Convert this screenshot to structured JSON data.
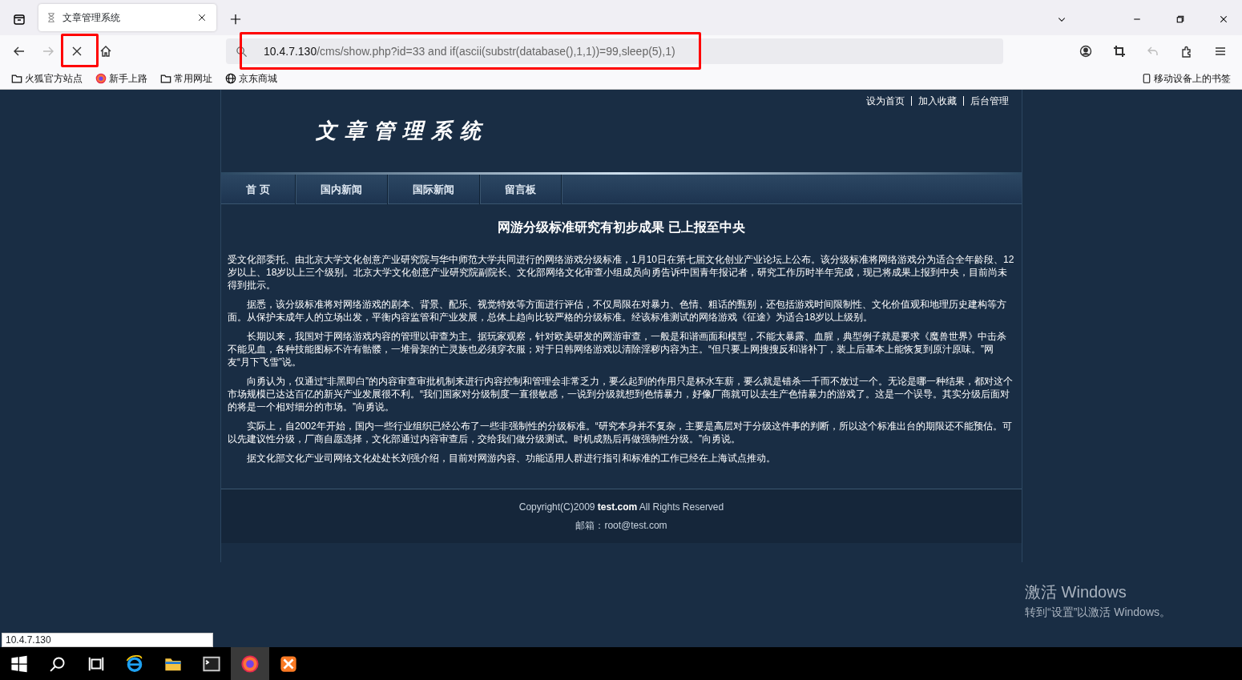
{
  "browser": {
    "tabs": [
      {
        "title": "文章管理系统",
        "selected": true,
        "loading": true
      }
    ],
    "nav_buttons": [
      {
        "kind": "back",
        "disabled": false
      },
      {
        "kind": "forward",
        "disabled": true
      },
      {
        "kind": "stop",
        "disabled": false,
        "highlighted": true
      },
      {
        "kind": "home",
        "disabled": false
      }
    ],
    "url": {
      "host": "10.4.7.130",
      "path": "/cms/show.php?id=33 and if(ascii(substr(database(),1,1))=99,sleep(5),1)",
      "highlighted": true
    },
    "bookmarks": [
      {
        "kind": "folder",
        "label": "火狐官方站点"
      },
      {
        "kind": "firefox",
        "label": "新手上路"
      },
      {
        "kind": "folder",
        "label": "常用网址"
      },
      {
        "kind": "globe",
        "label": "京东商城"
      }
    ],
    "mobile_bookmarks": "移动设备上的书签"
  },
  "page": {
    "top_links": [
      "设为首页",
      "加入收藏",
      "后台管理"
    ],
    "logo": "文章管理系统",
    "nav": [
      "首 页",
      "国内新闻",
      "国际新闻",
      "留言板"
    ],
    "article": {
      "title": "网游分级标准研究有初步成果 已上报至中央",
      "paragraphs": [
        {
          "indented": false,
          "text": "受文化部委托、由北京大学文化创意产业研究院与华中师范大学共同进行的网络游戏分级标准，1月10日在第七届文化创业产业论坛上公布。该分级标准将网络游戏分为适合全年龄段、12岁以上、18岁以上三个级别。北京大学文化创意产业研究院副院长、文化部网络文化审查小组成员向勇告诉中国青年报记者，研究工作历时半年完成，现已将成果上报到中央，目前尚未得到批示。"
        },
        {
          "indented": true,
          "text": "据悉，该分级标准将对网络游戏的剧本、背景、配乐、视觉特效等方面进行评估，不仅局限在对暴力、色情、粗话的甄别，还包括游戏时间限制性、文化价值观和地理历史建构等方面。从保护未成年人的立场出发，平衡内容监管和产业发展，总体上趋向比较严格的分级标准。经该标准测试的网络游戏《征途》为适合18岁以上级别。"
        },
        {
          "indented": true,
          "text": "长期以来，我国对于网络游戏内容的管理以审查为主。据玩家观察，针对欧美研发的网游审查，一般是和谐画面和模型，不能太暴露、血腥，典型例子就是要求《魔兽世界》中击杀不能见血，各种技能图标不许有骷髅，一堆骨架的亡灵族也必须穿衣服；对于日韩网络游戏以清除淫秽内容为主。“但只要上网搜搜反和谐补丁，装上后基本上能恢复到原汁原味。”网友“月下飞雪”说。"
        },
        {
          "indented": true,
          "text": "向勇认为，仅通过“非黑即白”的内容审查审批机制来进行内容控制和管理会非常乏力，要么起到的作用只是杯水车薪，要么就是错杀一千而不放过一个。无论是哪一种结果，都对这个市场规模已达达百亿的新兴产业发展很不利。“我们国家对分级制度一直很敏感，一说到分级就想到色情暴力，好像厂商就可以去生产色情暴力的游戏了。这是一个误导。其实分级后面对的将是一个相对细分的市场。”向勇说。"
        },
        {
          "indented": true,
          "text": "实际上，自2002年开始，国内一些行业组织已经公布了一些非强制性的分级标准。“研究本身并不复杂，主要是高层对于分级这件事的判断，所以这个标准出台的期限还不能预估。可以先建议性分级，厂商自愿选择，文化部通过内容审查后，交给我们做分级测试。时机成熟后再做强制性分级。”向勇说。"
        },
        {
          "indented": true,
          "text": "据文化部文化产业司网络文化处处长刘强介绍，目前对网游内容、功能适用人群进行指引和标准的工作已经在上海试点推动。"
        }
      ]
    },
    "footer": {
      "copyright": "Copyright(C)2009 **test.com** All Rights Reserved",
      "email": "邮箱：root@test.com"
    }
  },
  "status_text": "10.4.7.130",
  "activation": {
    "title": "激活 Windows",
    "subtitle": "转到“设置”以激活 Windows。"
  },
  "taskbar": [
    {
      "kind": "start",
      "selected": false
    },
    {
      "kind": "search",
      "selected": false
    },
    {
      "kind": "taskview",
      "selected": false
    },
    {
      "kind": "ie",
      "selected": false
    },
    {
      "kind": "explorer",
      "selected": false
    },
    {
      "kind": "terminal",
      "selected": false
    },
    {
      "kind": "firefox",
      "selected": true
    },
    {
      "kind": "xampp",
      "selected": false
    }
  ]
}
